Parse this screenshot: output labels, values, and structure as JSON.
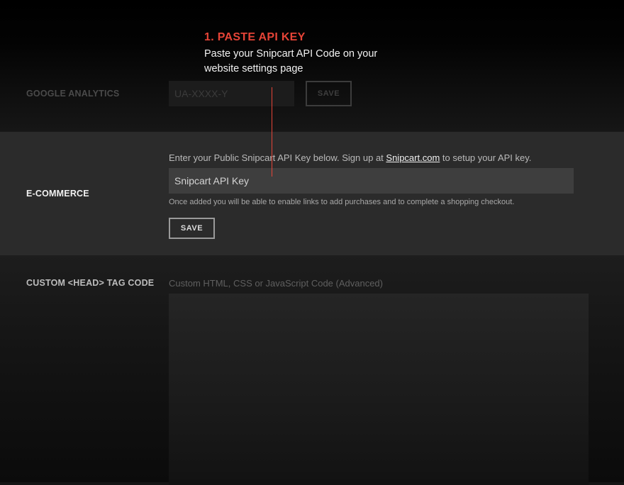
{
  "callout": {
    "title": "1. PASTE API KEY",
    "text": "Paste your Snipcart API Code on your website settings page",
    "color": "#e64437"
  },
  "google_analytics": {
    "label": "GOOGLE ANALYTICS",
    "placeholder": "UA-XXXX-Y",
    "save_label": "SAVE"
  },
  "ecommerce": {
    "label": "E-COMMERCE",
    "intro_before": "Enter your Public Snipcart API Key below. Sign up at ",
    "link_text": "Snipcart.com",
    "intro_after": " to setup your API key.",
    "api_placeholder": "Snipcart API Key",
    "hint": "Once added you will be able to enable links to add purchases and to complete a shopping checkout.",
    "save_label": "SAVE"
  },
  "custom_head": {
    "label": "CUSTOM <HEAD> TAG CODE",
    "caption": "Custom HTML, CSS or JavaScript Code (Advanced)"
  }
}
